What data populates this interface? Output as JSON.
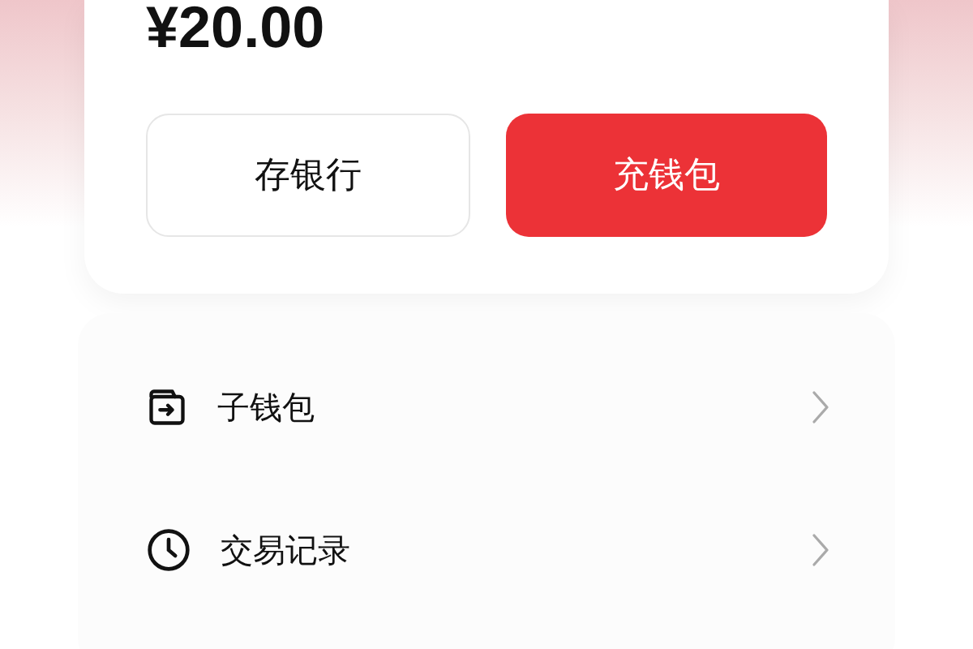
{
  "balance": {
    "amount": "¥20.00"
  },
  "buttons": [
    {
      "label": "存银行",
      "kind": "outline"
    },
    {
      "label": "充钱包",
      "kind": "filled"
    }
  ],
  "menu": [
    {
      "label": "子钱包"
    },
    {
      "label": "交易记录"
    }
  ]
}
